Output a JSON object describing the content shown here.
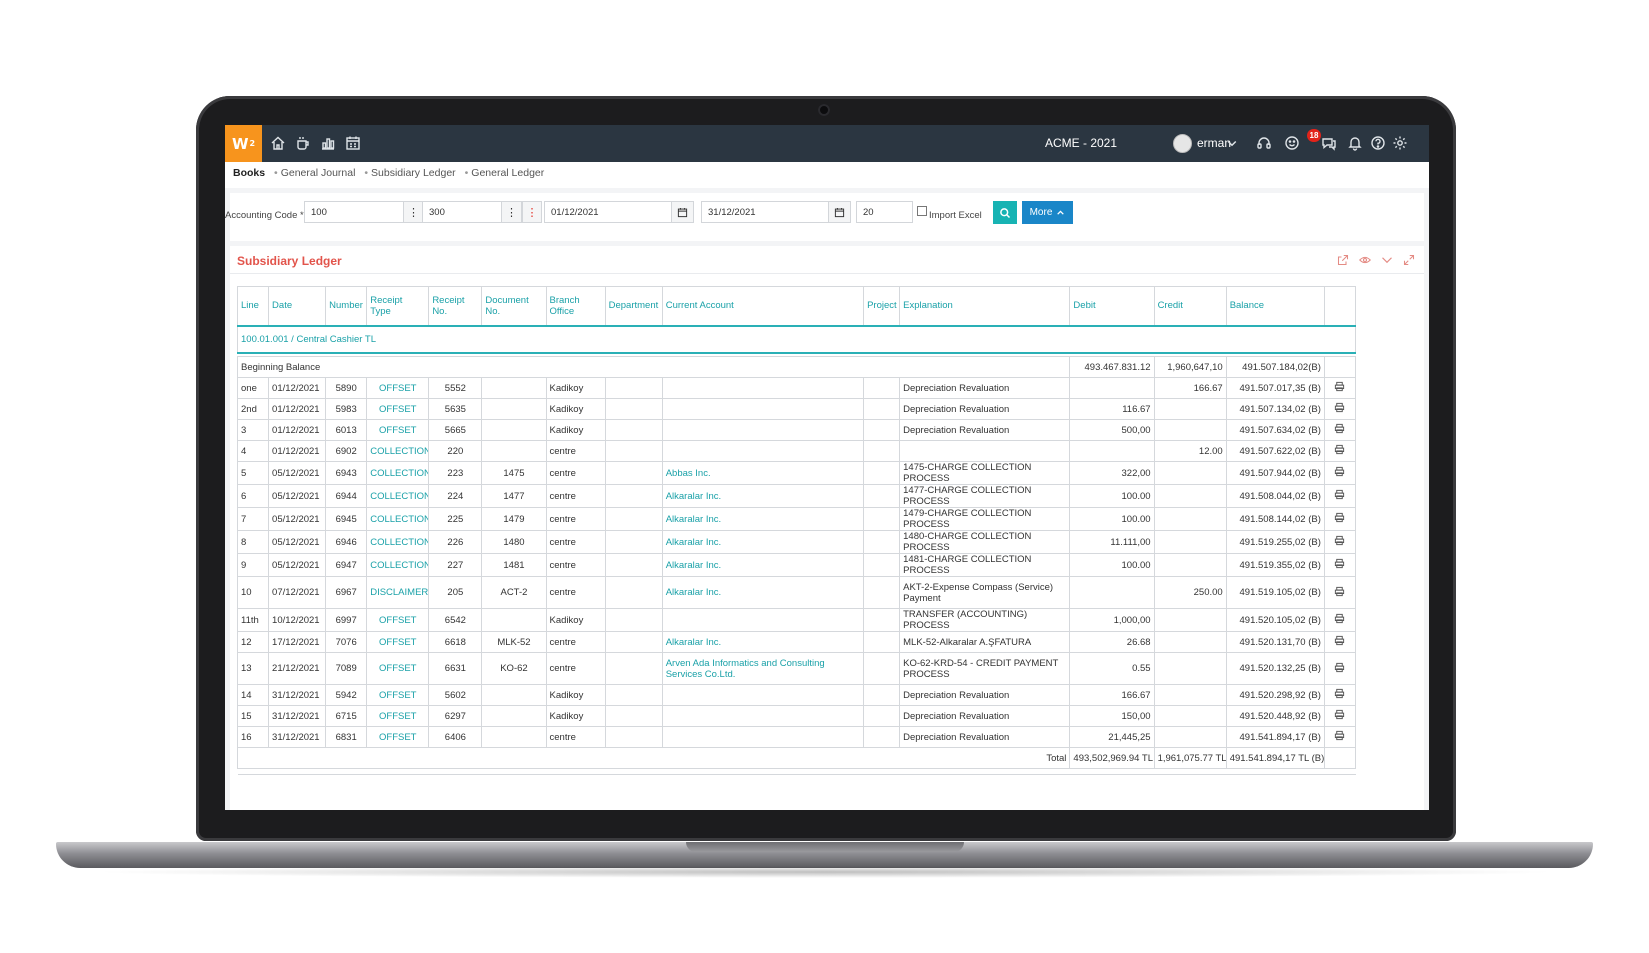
{
  "topbar": {
    "logo": "W",
    "logo_sup": "2",
    "company": "ACME - 2021",
    "user": "erman",
    "notification_count": "18",
    "icons": [
      "home-icon",
      "coffee-icon",
      "bar-chart-icon",
      "calendar-icon",
      "headset-icon",
      "emoji-icon",
      "chat-icon",
      "bell-icon",
      "help-icon",
      "gear-icon"
    ]
  },
  "breadcrumb": {
    "items": [
      "Books",
      "General Journal",
      "Subsidiary Ledger",
      "General Ledger"
    ]
  },
  "filters": {
    "accounting_code_label": "Accounting Code *",
    "code_from": "100",
    "code_to": "300",
    "date_from": "01/12/2021",
    "date_to": "31/12/2021",
    "page_size": "20",
    "import_excel_label": "Import Excel",
    "more_label": "More"
  },
  "ledger": {
    "title": "Subsidiary Ledger",
    "columns": [
      "Line",
      "Date",
      "Number",
      "Receipt Type",
      "Receipt No.",
      "Document No.",
      "Branch Office",
      "Department",
      "Current Account",
      "Project",
      "Explanation",
      "Debit",
      "Credit",
      "Balance"
    ],
    "group_label": "100.01.001 / Central Cashier TL",
    "beginning": {
      "label": "Beginning Balance",
      "debit": "493.467.831.12",
      "credit": "1,960,647,10",
      "balance": "491.507.184,02(B)"
    },
    "rows": [
      {
        "line": "one",
        "date": "01/12/2021",
        "number": "5890",
        "type": "OFFSET",
        "receipt": "5552",
        "doc": "",
        "branch": "Kadikoy",
        "dept": "",
        "account": "",
        "project": "",
        "explanation": "Depreciation Revaluation",
        "debit": "",
        "credit": "166.67",
        "balance": "491.507.017,35 (B)"
      },
      {
        "line": "2nd",
        "date": "01/12/2021",
        "number": "5983",
        "type": "OFFSET",
        "receipt": "5635",
        "doc": "",
        "branch": "Kadikoy",
        "dept": "",
        "account": "",
        "project": "",
        "explanation": "Depreciation Revaluation",
        "debit": "116.67",
        "credit": "",
        "balance": "491.507.134,02 (B)"
      },
      {
        "line": "3",
        "date": "01/12/2021",
        "number": "6013",
        "type": "OFFSET",
        "receipt": "5665",
        "doc": "",
        "branch": "Kadikoy",
        "dept": "",
        "account": "",
        "project": "",
        "explanation": "Depreciation Revaluation",
        "debit": "500,00",
        "credit": "",
        "balance": "491.507.634,02 (B)"
      },
      {
        "line": "4",
        "date": "01/12/2021",
        "number": "6902",
        "type": "COLLECTION",
        "receipt": "220",
        "doc": "",
        "branch": "centre",
        "dept": "",
        "account": "",
        "project": "",
        "explanation": "",
        "debit": "",
        "credit": "12.00",
        "balance": "491.507.622,02 (B)"
      },
      {
        "line": "5",
        "date": "05/12/2021",
        "number": "6943",
        "type": "COLLECTION",
        "receipt": "223",
        "doc": "1475",
        "branch": "centre",
        "dept": "",
        "account": "Abbas Inc.",
        "project": "",
        "explanation": "1475-CHARGE COLLECTION PROCESS",
        "debit": "322,00",
        "credit": "",
        "balance": "491.507.944,02 (B)"
      },
      {
        "line": "6",
        "date": "05/12/2021",
        "number": "6944",
        "type": "COLLECTION",
        "receipt": "224",
        "doc": "1477",
        "branch": "centre",
        "dept": "",
        "account": "Alkaralar Inc.",
        "project": "",
        "explanation": "1477-CHARGE COLLECTION PROCESS",
        "debit": "100.00",
        "credit": "",
        "balance": "491.508.044,02 (B)"
      },
      {
        "line": "7",
        "date": "05/12/2021",
        "number": "6945",
        "type": "COLLECTION",
        "receipt": "225",
        "doc": "1479",
        "branch": "centre",
        "dept": "",
        "account": "Alkaralar Inc.",
        "project": "",
        "explanation": "1479-CHARGE COLLECTION PROCESS",
        "debit": "100.00",
        "credit": "",
        "balance": "491.508.144,02 (B)"
      },
      {
        "line": "8",
        "date": "05/12/2021",
        "number": "6946",
        "type": "COLLECTION",
        "receipt": "226",
        "doc": "1480",
        "branch": "centre",
        "dept": "",
        "account": "Alkaralar Inc.",
        "project": "",
        "explanation": "1480-CHARGE COLLECTION PROCESS",
        "debit": "11.111,00",
        "credit": "",
        "balance": "491.519.255,02 (B)"
      },
      {
        "line": "9",
        "date": "05/12/2021",
        "number": "6947",
        "type": "COLLECTION",
        "receipt": "227",
        "doc": "1481",
        "branch": "centre",
        "dept": "",
        "account": "Alkaralar Inc.",
        "project": "",
        "explanation": "1481-CHARGE COLLECTION PROCESS",
        "debit": "100.00",
        "credit": "",
        "balance": "491.519.355,02 (B)"
      },
      {
        "line": "10",
        "date": "07/12/2021",
        "number": "6967",
        "type": "DISCLAIMER",
        "receipt": "205",
        "doc": "ACT-2",
        "branch": "centre",
        "dept": "",
        "account": "Alkaralar Inc.",
        "project": "",
        "explanation": "AKT-2-Expense Compass (Service) Payment",
        "debit": "",
        "credit": "250.00",
        "balance": "491.519.105,02 (B)",
        "tall": true
      },
      {
        "line": "11th",
        "date": "10/12/2021",
        "number": "6997",
        "type": "OFFSET",
        "receipt": "6542",
        "doc": "",
        "branch": "Kadikoy",
        "dept": "",
        "account": "",
        "project": "",
        "explanation": "TRANSFER (ACCOUNTING) PROCESS",
        "debit": "1,000,00",
        "credit": "",
        "balance": "491.520.105,02 (B)"
      },
      {
        "line": "12",
        "date": "17/12/2021",
        "number": "7076",
        "type": "OFFSET",
        "receipt": "6618",
        "doc": "MLK-52",
        "branch": "centre",
        "dept": "",
        "account": "Alkaralar Inc.",
        "project": "",
        "explanation": "MLK-52-Alkaralar A.ŞFATURA",
        "debit": "26.68",
        "credit": "",
        "balance": "491.520.131,70 (B)"
      },
      {
        "line": "13",
        "date": "21/12/2021",
        "number": "7089",
        "type": "OFFSET",
        "receipt": "6631",
        "doc": "KO-62",
        "branch": "centre",
        "dept": "",
        "account": "Arven Ada Informatics and Consulting Services Co.Ltd.",
        "project": "",
        "explanation": "KO-62-KRD-54 - CREDIT PAYMENT PROCESS",
        "debit": "0.55",
        "credit": "",
        "balance": "491.520.132,25 (B)",
        "tall": true
      },
      {
        "line": "14",
        "date": "31/12/2021",
        "number": "5942",
        "type": "OFFSET",
        "receipt": "5602",
        "doc": "",
        "branch": "Kadikoy",
        "dept": "",
        "account": "",
        "project": "",
        "explanation": "Depreciation Revaluation",
        "debit": "166.67",
        "credit": "",
        "balance": "491.520.298,92 (B)"
      },
      {
        "line": "15",
        "date": "31/12/2021",
        "number": "6715",
        "type": "OFFSET",
        "receipt": "6297",
        "doc": "",
        "branch": "Kadikoy",
        "dept": "",
        "account": "",
        "project": "",
        "explanation": "Depreciation Revaluation",
        "debit": "150,00",
        "credit": "",
        "balance": "491.520.448,92 (B)"
      },
      {
        "line": "16",
        "date": "31/12/2021",
        "number": "6831",
        "type": "OFFSET",
        "receipt": "6406",
        "doc": "",
        "branch": "centre",
        "dept": "",
        "account": "",
        "project": "",
        "explanation": "Depreciation Revaluation",
        "debit": "21,445,25",
        "credit": "",
        "balance": "491.541.894,17 (B)"
      }
    ],
    "total": {
      "label": "Total",
      "debit": "493,502,969.94 TL",
      "credit": "1,961,075.77 TL",
      "balance": "491.541.894,17 TL (B)"
    }
  },
  "colors": {
    "topbar": "#2b3641",
    "logo": "#f7941d",
    "accent": "#1aa1a8",
    "title": "#e2544b",
    "search_button": "#17b3b3",
    "more_button": "#1a86c8"
  }
}
